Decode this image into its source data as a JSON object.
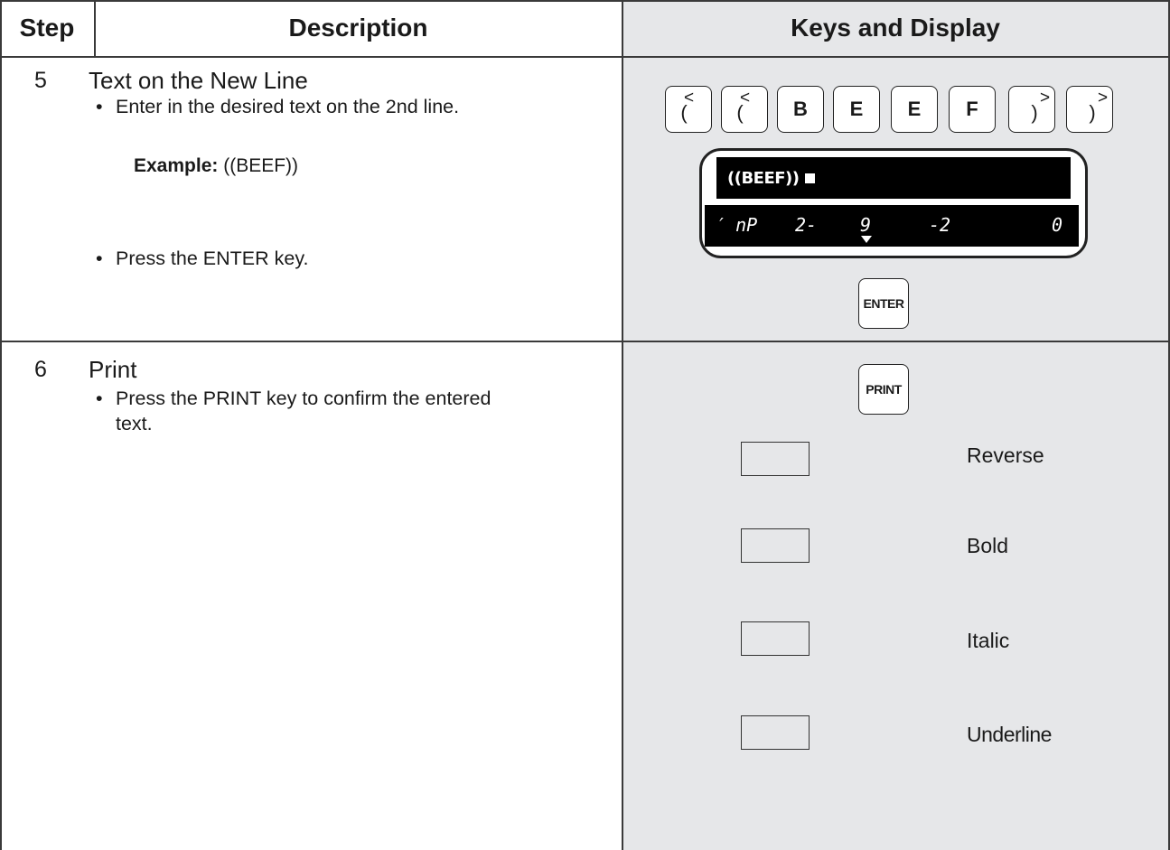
{
  "headers": {
    "step": "Step",
    "description": "Description",
    "keys": "Keys and Display"
  },
  "step5": {
    "number": "5",
    "title": "Text on the New Line",
    "bullet1": "Enter in the desired text on the 2nd line.",
    "example_label": "Example:",
    "example_value": "((BEEF))",
    "bullet2": "Press the ENTER key.",
    "keys": [
      {
        "main": "(",
        "sup": "<"
      },
      {
        "main": "(",
        "sup": "<"
      },
      {
        "main": "B",
        "sup": ""
      },
      {
        "main": "E",
        "sup": ""
      },
      {
        "main": "E",
        "sup": ""
      },
      {
        "main": "F",
        "sup": ""
      },
      {
        "main": ")",
        "sup": ">"
      },
      {
        "main": ")",
        "sup": ">"
      }
    ],
    "display_line1": "((BEEF))",
    "display_line2": [
      "′ nP",
      "2-",
      "9",
      "-2",
      "0"
    ],
    "enter_key": "ENTER"
  },
  "step6": {
    "number": "6",
    "title": "Print",
    "bullet1_line1": "Press the PRINT key to confirm the entered",
    "bullet1_line2": "text.",
    "print_key": "PRINT",
    "options": [
      "Reverse",
      "Bold",
      "Italic",
      "Underline"
    ]
  }
}
